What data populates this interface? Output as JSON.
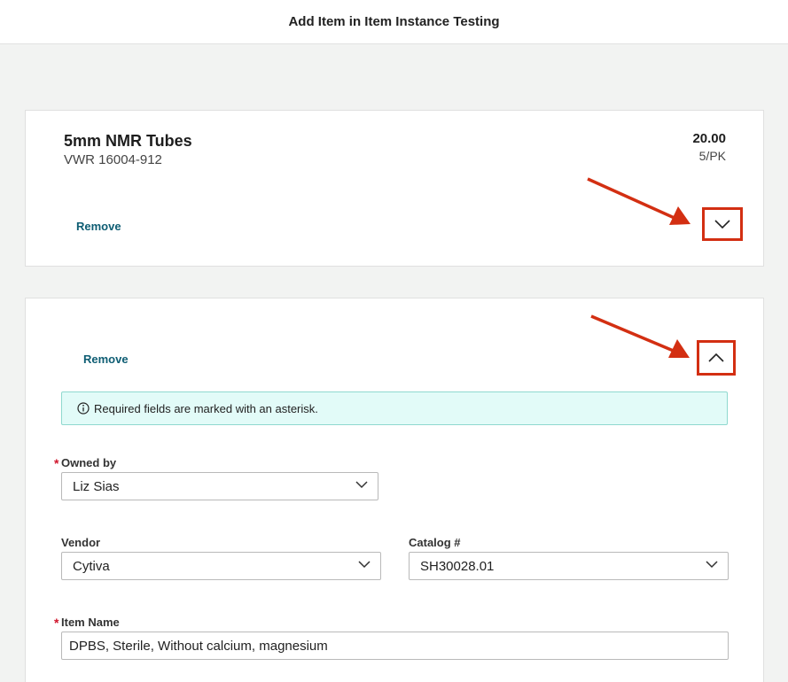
{
  "header": {
    "title": "Add Item in Item Instance Testing"
  },
  "item1": {
    "name": "5mm NMR Tubes",
    "vendor_catalog": "VWR  16004-912",
    "price": "20.00",
    "unit": "5/PK",
    "remove_label": "Remove",
    "toggle_state": "collapsed"
  },
  "item2": {
    "remove_label": "Remove",
    "toggle_state": "expanded",
    "info_text": "Required fields are marked with an asterisk.",
    "owned_by": {
      "label": "Owned by",
      "required_mark": "*",
      "value": "Liz Sias"
    },
    "vendor": {
      "label": "Vendor",
      "value": "Cytiva"
    },
    "catalog": {
      "label": "Catalog #",
      "value": "SH30028.01"
    },
    "item_name": {
      "label": "Item Name",
      "required_mark": "*",
      "value": "DPBS, Sterile, Without calcium, magnesium"
    }
  },
  "colors": {
    "annotation_red": "#d32f12",
    "link_teal": "#0e5d73",
    "info_bg": "#e2fbf8",
    "required_red": "#d0142b"
  }
}
